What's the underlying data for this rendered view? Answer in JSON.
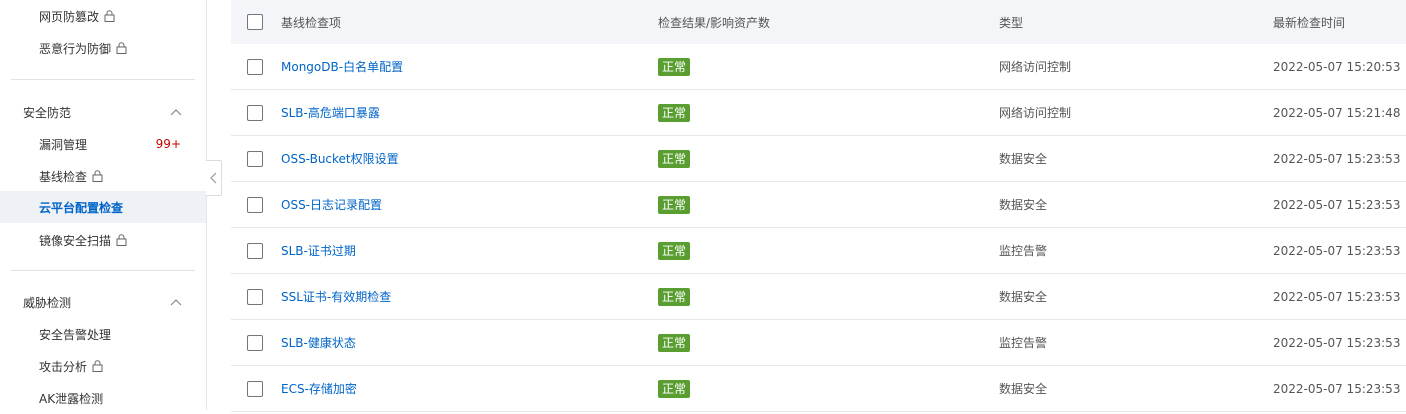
{
  "sidebar": {
    "top_items": [
      {
        "label": "网页防篡改",
        "locked": true
      },
      {
        "label": "恶意行为防御",
        "locked": true
      }
    ],
    "group_security": {
      "label": "安全防范",
      "items": [
        {
          "label": "漏洞管理",
          "badge": "99+"
        },
        {
          "label": "基线检查",
          "locked": true
        },
        {
          "label": "云平台配置检查",
          "active": true
        },
        {
          "label": "镜像安全扫描",
          "locked": true
        }
      ]
    },
    "group_threat": {
      "label": "威胁检测",
      "items": [
        {
          "label": "安全告警处理"
        },
        {
          "label": "攻击分析",
          "locked": true
        },
        {
          "label": "AK泄露检测"
        }
      ]
    }
  },
  "table": {
    "headers": {
      "name": "基线检查项",
      "result": "检查结果/影响资产数",
      "type": "类型",
      "time": "最新检查时间"
    },
    "rows": [
      {
        "name": "MongoDB-白名单配置",
        "status": "正常",
        "type": "网络访问控制",
        "time": "2022-05-07 15:20:53"
      },
      {
        "name": "SLB-高危端口暴露",
        "status": "正常",
        "type": "网络访问控制",
        "time": "2022-05-07 15:21:48"
      },
      {
        "name": "OSS-Bucket权限设置",
        "status": "正常",
        "type": "数据安全",
        "time": "2022-05-07 15:23:53"
      },
      {
        "name": "OSS-日志记录配置",
        "status": "正常",
        "type": "数据安全",
        "time": "2022-05-07 15:23:53"
      },
      {
        "name": "SLB-证书过期",
        "status": "正常",
        "type": "监控告警",
        "time": "2022-05-07 15:23:53"
      },
      {
        "name": "SSL证书-有效期检查",
        "status": "正常",
        "type": "数据安全",
        "time": "2022-05-07 15:23:53"
      },
      {
        "name": "SLB-健康状态",
        "status": "正常",
        "type": "监控告警",
        "time": "2022-05-07 15:23:53"
      },
      {
        "name": "ECS-存储加密",
        "status": "正常",
        "type": "数据安全",
        "time": "2022-05-07 15:23:53"
      }
    ]
  },
  "colors": {
    "link": "#0064c8",
    "status_ok": "#5a9e32",
    "badge": "#c80000",
    "active_bg": "#eef1f6"
  }
}
